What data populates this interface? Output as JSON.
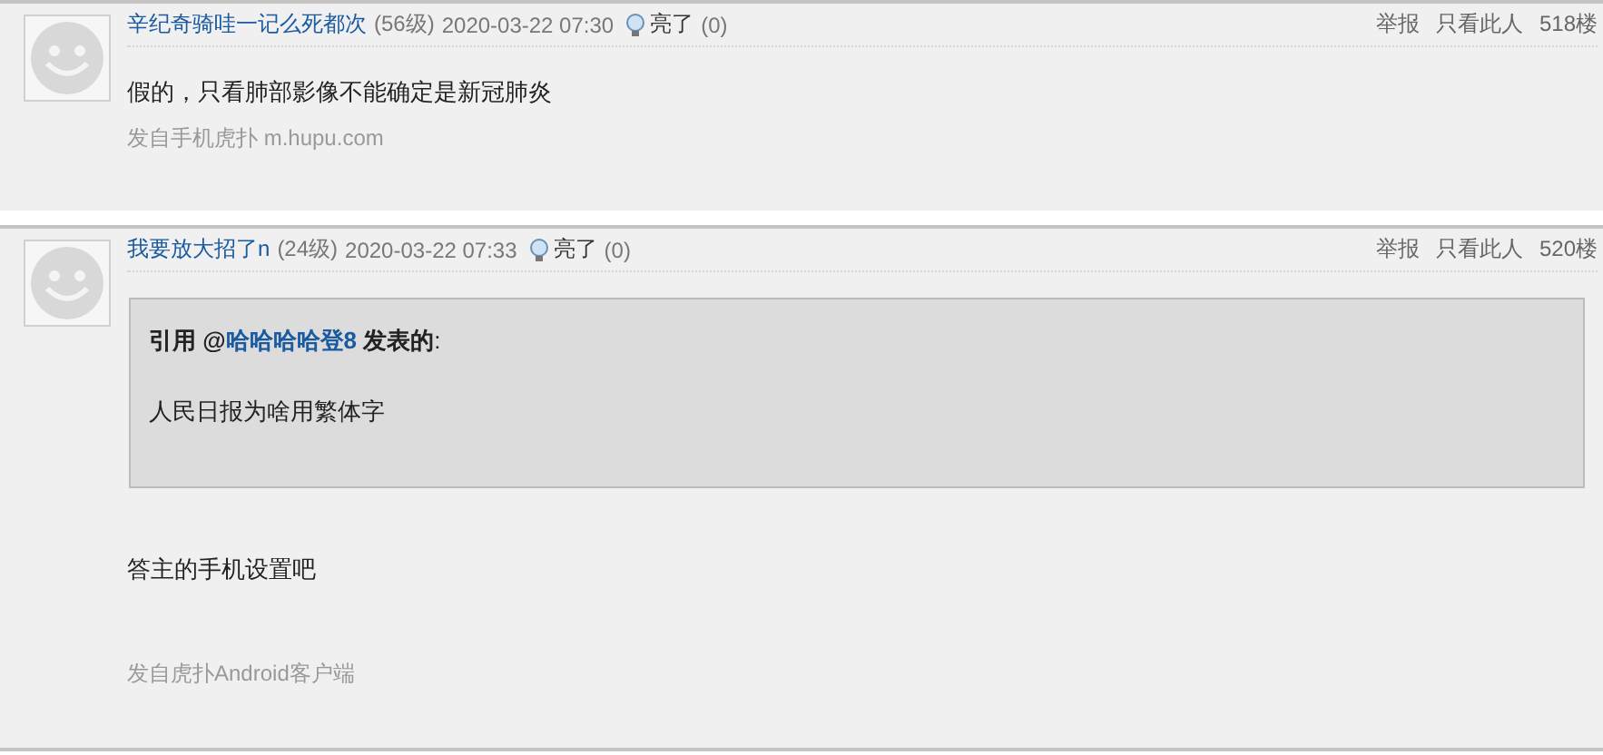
{
  "posts": [
    {
      "username": "辛纪奇骑哇一记么死都次",
      "level": "(56级)",
      "time": "2020-03-22 07:30",
      "light_label": "亮了",
      "light_count": "(0)",
      "report": "举报",
      "only_author": "只看此人",
      "floor": "518楼",
      "body": "假的，只看肺部影像不能确定是新冠肺炎",
      "source": "发自手机虎扑 m.hupu.com"
    },
    {
      "username": "我要放大招了n",
      "level": "(24级)",
      "time": "2020-03-22 07:33",
      "light_label": "亮了",
      "light_count": "(0)",
      "report": "举报",
      "only_author": "只看此人",
      "floor": "520楼",
      "quote": {
        "prefix": "引用 @",
        "user": "哈哈哈哈登8",
        "suffix": " 发表的",
        "colon": ":",
        "text": "人民日报为啥用繁体字"
      },
      "body": "答主的手机设置吧",
      "source": "发自虎扑Android客户端"
    }
  ]
}
